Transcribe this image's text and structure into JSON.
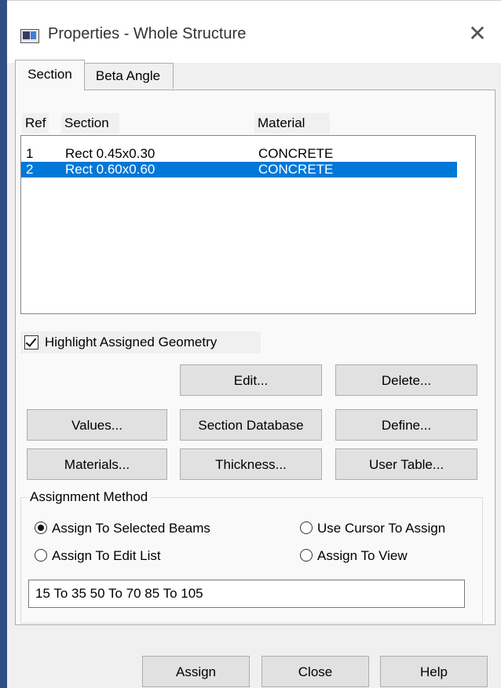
{
  "window": {
    "title": "Properties - Whole Structure",
    "close_glyph": "✕"
  },
  "tabs": [
    {
      "label": "Section",
      "active": true
    },
    {
      "label": "Beta Angle",
      "active": false
    }
  ],
  "table": {
    "columns": [
      "Ref",
      "Section",
      "Material"
    ],
    "rows": [
      {
        "ref": "1",
        "section": "Rect 0.45x0.30",
        "material": "CONCRETE",
        "selected": false
      },
      {
        "ref": "2",
        "section": "Rect 0.60x0.60",
        "material": "CONCRETE",
        "selected": true
      }
    ]
  },
  "highlight_checkbox": {
    "label": "Highlight Assigned Geometry",
    "checked": true
  },
  "buttons": {
    "edit": "Edit...",
    "delete": "Delete...",
    "values": "Values...",
    "section_database": "Section Database",
    "define": "Define...",
    "materials": "Materials...",
    "thickness": "Thickness...",
    "user_table": "User Table..."
  },
  "assignment": {
    "title": "Assignment Method",
    "options": [
      {
        "label": "Assign To Selected Beams",
        "selected": true
      },
      {
        "label": "Use Cursor To Assign",
        "selected": false
      },
      {
        "label": "Assign To Edit List",
        "selected": false
      },
      {
        "label": "Assign To View",
        "selected": false
      }
    ],
    "edit_list_value": "15 To 35 50 To 70 85 To 105"
  },
  "footer": {
    "assign": "Assign",
    "close": "Close",
    "help": "Help"
  },
  "colors": {
    "selection": "#0078d7",
    "left_bar": "#2e4f82",
    "dialog_bg": "#f0f0f0"
  }
}
